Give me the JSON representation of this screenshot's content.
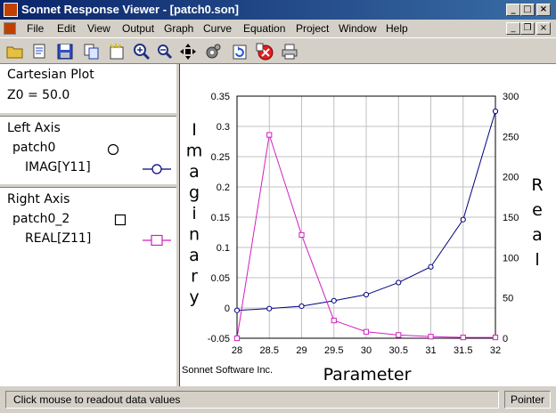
{
  "window": {
    "title": "Sonnet Response Viewer - [patch0.son]",
    "minimize_glyph": "_",
    "maximize_glyph": "□",
    "restore_glyph": "❐",
    "close_glyph": "×"
  },
  "menu": {
    "items": [
      "File",
      "Edit",
      "View",
      "Output",
      "Graph",
      "Curve",
      "Equation",
      "Project",
      "Window",
      "Help"
    ]
  },
  "toolbar": {
    "icons": [
      "open-folder-icon",
      "open-project-icon",
      "save-icon",
      "copy-icon",
      "new-plot-icon",
      "zoom-in-icon",
      "zoom-out-icon",
      "pan-icon",
      "settings-icon",
      "refresh-icon",
      "stop-icon",
      "print-icon"
    ]
  },
  "left_panel": {
    "plot_title": "Cartesian Plot",
    "z0_label": "Z0 = 50.0",
    "left_axis": {
      "heading": "Left Axis",
      "project": "patch0",
      "curve": "IMAG[Y11]"
    },
    "right_axis": {
      "heading": "Right Axis",
      "project": "patch0_2",
      "curve": "REAL[Z11]"
    }
  },
  "chart_data": {
    "type": "line",
    "xlabel": "Parameter",
    "ylabel": "Imaginary",
    "y2label": "Real",
    "credit": "Sonnet Software Inc.",
    "x": [
      28,
      28.5,
      29,
      29.5,
      30,
      30.5,
      31,
      31.5,
      32
    ],
    "xlim": [
      28,
      32
    ],
    "ylim": [
      -0.05,
      0.35
    ],
    "y2lim": [
      0,
      300
    ],
    "xticks": [
      "28",
      "28.5",
      "29",
      "29.5",
      "30",
      "30.5",
      "31",
      "31.5",
      "32"
    ],
    "yticks": [
      "-0.05",
      "0",
      "0.05",
      "0.1",
      "0.15",
      "0.2",
      "0.25",
      "0.3",
      "0.35"
    ],
    "y2ticks": [
      "0",
      "50",
      "100",
      "150",
      "200",
      "250",
      "300"
    ],
    "grid": true,
    "series": [
      {
        "name": "IMAG[Y11]",
        "axis": "left",
        "marker": "circle",
        "color": "#000080",
        "values": [
          -0.004,
          -0.001,
          0.003,
          0.012,
          0.022,
          0.042,
          0.068,
          0.146,
          0.325
        ]
      },
      {
        "name": "REAL[Z11]",
        "axis": "right",
        "marker": "square",
        "color": "#d020c0",
        "values": [
          0,
          252,
          128,
          22,
          8,
          4,
          2,
          1,
          1
        ]
      }
    ]
  },
  "status": {
    "message": "Click mouse to readout data values",
    "mode": "Pointer"
  }
}
